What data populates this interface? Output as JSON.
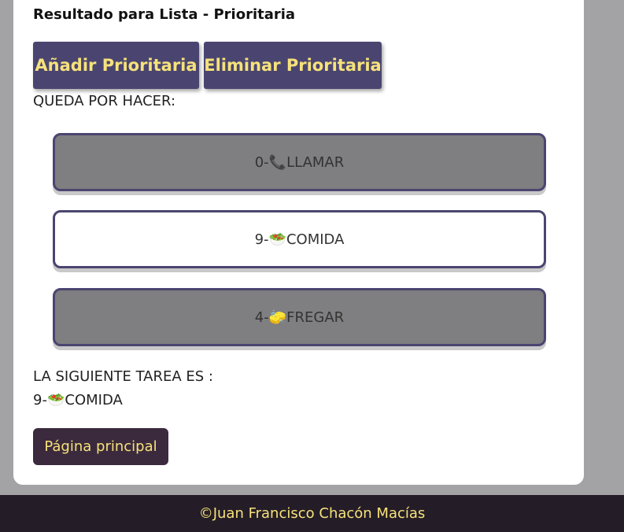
{
  "header": {
    "title": "Resultado para Lista - Prioritaria"
  },
  "actions": {
    "add_label": "Añadir Prioritaria",
    "remove_label": "Eliminar Prioritaria"
  },
  "pending": {
    "label": "QUEDA POR HACER:",
    "tasks": [
      {
        "priority": "0-",
        "emoji": "📞",
        "name": "LLAMAR",
        "state": "gray"
      },
      {
        "priority": "9-",
        "emoji": "🥗",
        "name": "COMIDA",
        "state": "white"
      },
      {
        "priority": "4-",
        "emoji": "🧽",
        "name": "FREGAR",
        "state": "gray"
      }
    ]
  },
  "next": {
    "label": "LA SIGUIENTE TAREA ES :",
    "priority": "9-",
    "emoji": "🥗",
    "name": "COMIDA"
  },
  "navigation": {
    "home_label": "Página principal"
  },
  "footer": {
    "text": "©Juan Francisco Chacón Macías"
  },
  "colors": {
    "accent": "#4a4570",
    "button_text": "#f6e27a",
    "footer_bg": "#241d27",
    "home_button_bg": "#3b2a3d",
    "highlight_task_bg": "#7f7e80"
  }
}
